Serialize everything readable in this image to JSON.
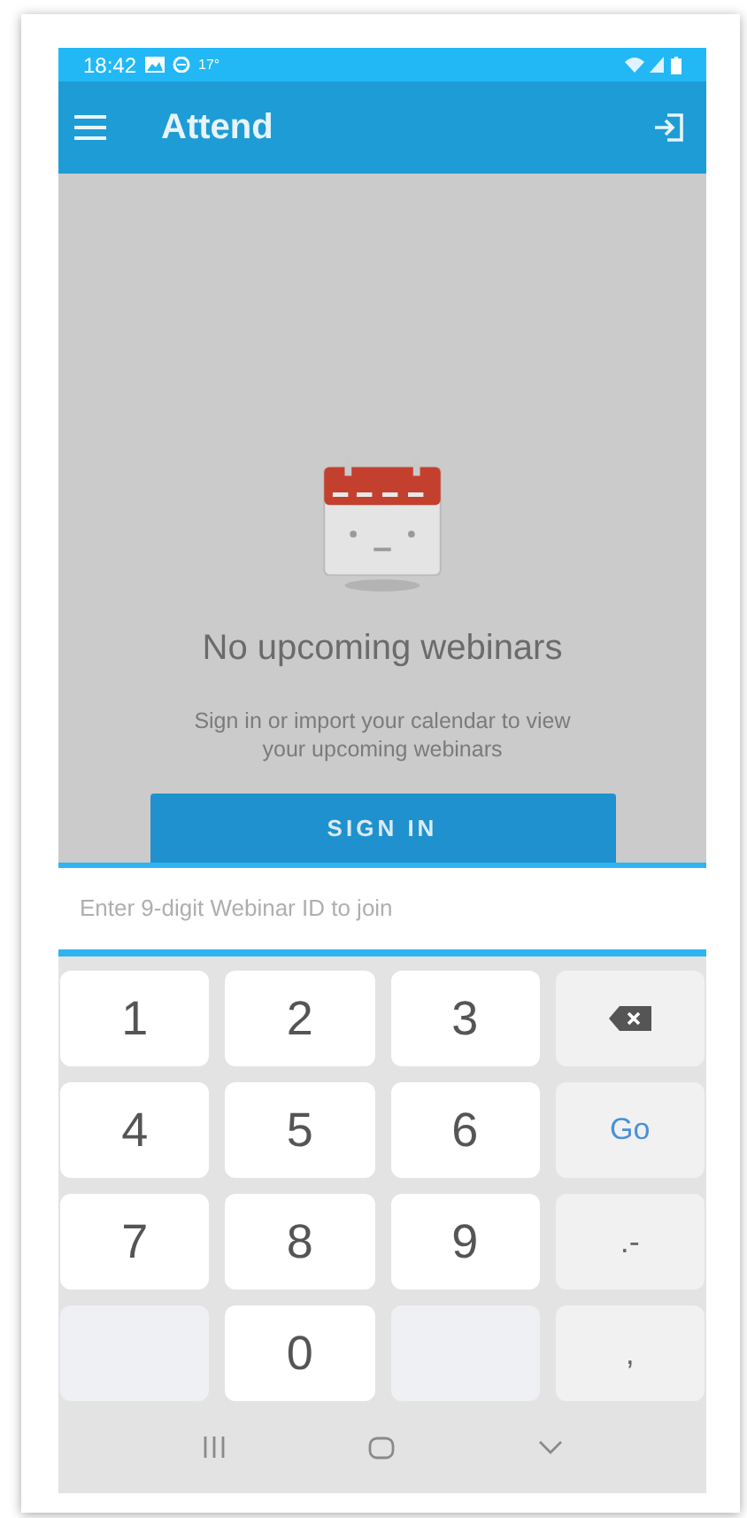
{
  "status_bar": {
    "time": "18:42",
    "temperature": "17°"
  },
  "app_bar": {
    "title": "Attend"
  },
  "empty_state": {
    "title": "No upcoming webinars",
    "message": "Sign in or import your calendar to view your upcoming webinars",
    "button": "SIGN IN"
  },
  "webinar_id_field": {
    "placeholder": "Enter 9-digit Webinar ID to join"
  },
  "keyboard": {
    "rows": [
      [
        {
          "kind": "digit",
          "label": "1"
        },
        {
          "kind": "digit",
          "label": "2"
        },
        {
          "kind": "digit",
          "label": "3"
        },
        {
          "kind": "backspace"
        }
      ],
      [
        {
          "kind": "digit",
          "label": "4"
        },
        {
          "kind": "digit",
          "label": "5"
        },
        {
          "kind": "digit",
          "label": "6"
        },
        {
          "kind": "go",
          "label": "Go"
        }
      ],
      [
        {
          "kind": "digit",
          "label": "7"
        },
        {
          "kind": "digit",
          "label": "8"
        },
        {
          "kind": "digit",
          "label": "9"
        },
        {
          "kind": "symbol",
          "label": ".-"
        }
      ],
      [
        {
          "kind": "blank"
        },
        {
          "kind": "digit",
          "label": "0"
        },
        {
          "kind": "blank"
        },
        {
          "kind": "symbol",
          "label": ","
        }
      ]
    ]
  }
}
